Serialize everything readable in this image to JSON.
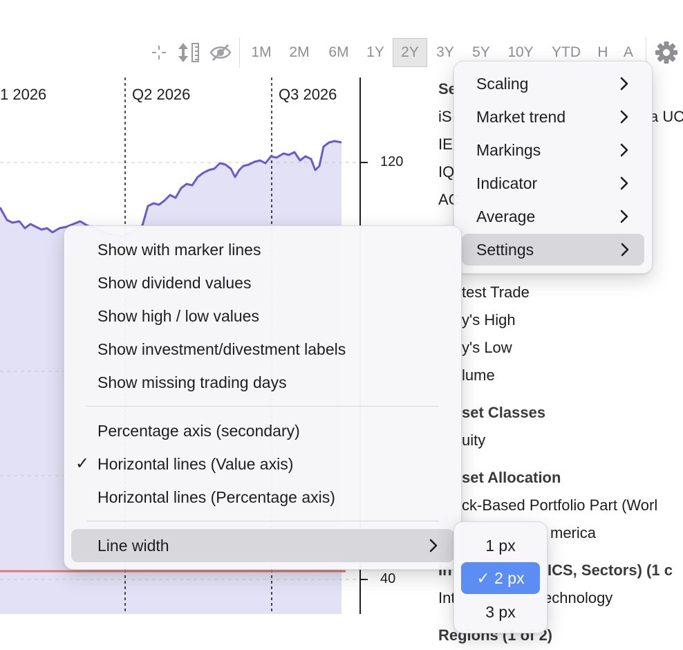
{
  "toolbar": {
    "icons": [
      "crosshair-icon",
      "vertical-resize-icon",
      "eye-slash-icon",
      "gear-icon"
    ],
    "ranges": [
      "1M",
      "2M",
      "6M",
      "1Y",
      "2Y",
      "3Y",
      "5Y",
      "10Y",
      "YTD",
      "H",
      "A"
    ],
    "active_range": "2Y"
  },
  "chart": {
    "quarter_labels": [
      "1 2026",
      "Q2 2026",
      "Q3 2026"
    ],
    "value_axis_labels": [
      "120",
      "40"
    ],
    "line_color": "#6a5acd",
    "area_color": "#e3e1f5",
    "reference_line_color": "#d97b7b"
  },
  "info_panel": {
    "lines": [
      "Se",
      "iS",
      "a UC",
      "IE",
      "IQ",
      "AC",
      "test Trade",
      "y's High",
      "y's Low",
      "lume",
      "set Classes",
      "uity",
      "set Allocation",
      "ck-Based Portfolio Part (Worl",
      "merica",
      "In",
      "ICS, Sectors) (1 c",
      "Int",
      "echnology",
      "Regions (1 of 2)"
    ]
  },
  "main_menu": {
    "items": [
      "Scaling",
      "Market trend",
      "Markings",
      "Indicator",
      "Average",
      "Settings"
    ],
    "highlighted": "Settings"
  },
  "settings_menu": {
    "group1": [
      "Show with marker lines",
      "Show dividend values",
      "Show high / low values",
      "Show investment/divestment labels",
      "Show missing trading days"
    ],
    "group2": [
      "Percentage axis (secondary)",
      "Horizontal lines (Value axis)",
      "Horizontal lines (Percentage axis)"
    ],
    "checked": "Horizontal lines (Value axis)",
    "line_width_label": "Line width",
    "check_mark": "✓"
  },
  "line_width_menu": {
    "options": [
      "1 px",
      "2 px",
      "3 px"
    ],
    "selected": "2 px",
    "check_mark": "✓"
  }
}
